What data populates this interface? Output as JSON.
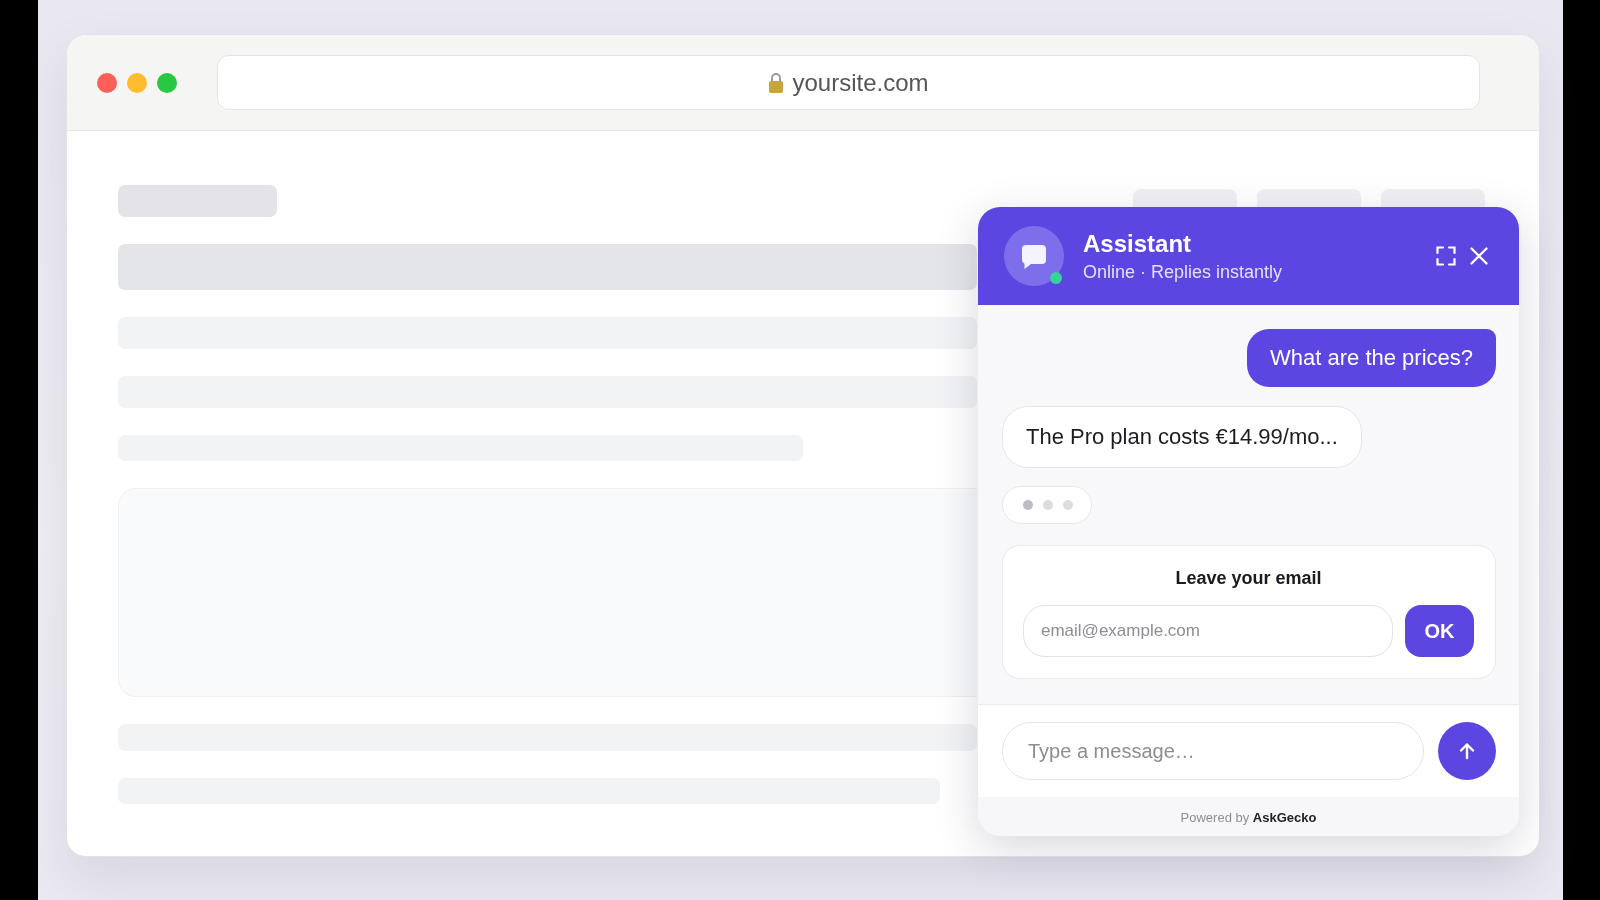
{
  "browser": {
    "url": "yoursite.com"
  },
  "chat": {
    "header": {
      "title": "Assistant",
      "subtitle": "Online · Replies instantly",
      "online": true
    },
    "messages": [
      {
        "kind": "user",
        "text": "What are the prices?"
      },
      {
        "kind": "assistant",
        "text": "The Pro plan costs €14.99/mo..."
      }
    ],
    "typing": true,
    "email_form": {
      "title": "Leave your email",
      "placeholder": "email@example.com",
      "button": "OK"
    },
    "composer": {
      "placeholder": "Type a message…"
    },
    "footer": "Powered by **AskGecko**"
  }
}
